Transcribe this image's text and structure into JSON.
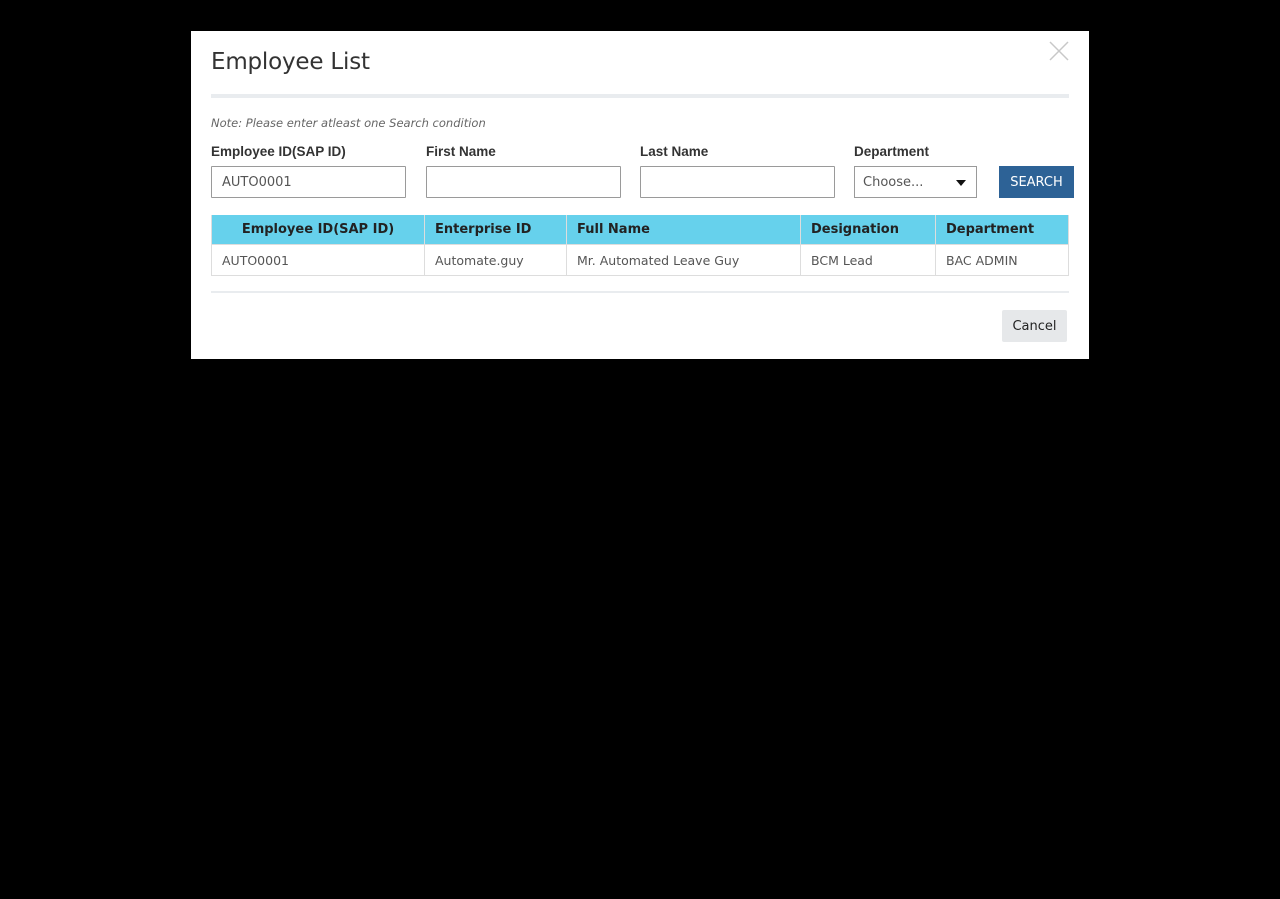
{
  "modal": {
    "title": "Employee List",
    "note": "Note: Please enter atleast one Search condition",
    "close_icon": "close-icon"
  },
  "search": {
    "employee_id_label": "Employee ID(SAP ID)",
    "employee_id_value": "AUTO0001",
    "first_name_label": "First Name",
    "first_name_value": "",
    "last_name_label": "Last Name",
    "last_name_value": "",
    "department_label": "Department",
    "department_selected": "Choose...",
    "search_label": "SEARCH"
  },
  "table": {
    "columns": [
      "Employee ID(SAP ID)",
      "Enterprise ID",
      "Full Name",
      "Designation",
      "Department"
    ],
    "rows": [
      [
        "AUTO0001",
        "Automate.guy",
        "Mr. Automated Leave Guy",
        "BCM Lead",
        "BAC ADMIN"
      ]
    ]
  },
  "footer": {
    "cancel_label": "Cancel"
  },
  "colors": {
    "header_bg": "#66d1ec",
    "primary_button": "#2d6296",
    "secondary_button": "#e6e8ea",
    "backdrop": "#000000"
  }
}
